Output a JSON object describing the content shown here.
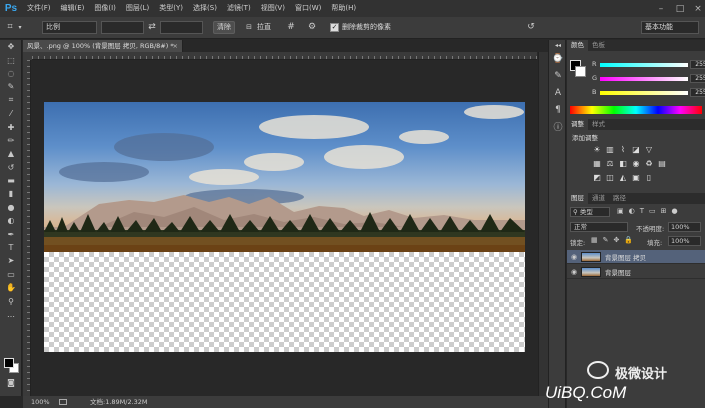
{
  "app": {
    "logo": "Ps"
  },
  "menu": [
    "文件(F)",
    "编辑(E)",
    "图像(I)",
    "图层(L)",
    "类型(Y)",
    "选择(S)",
    "滤镜(T)",
    "视图(V)",
    "窗口(W)",
    "帮助(H)"
  ],
  "options": {
    "ratio": "比例",
    "clear_label": "清除",
    "straighten_label": "拉直",
    "delete_pixels_label": "删除裁剪的像素",
    "delete_pixels_checked": true,
    "workspace": "基本功能"
  },
  "document": {
    "tab_title": "风景、.png @ 100% (背景图层 拷贝, RGB/8#) *",
    "close": "×"
  },
  "status": {
    "zoom": "100%",
    "doc_size": "文档:1.89M/2.32M"
  },
  "color_panel": {
    "tabs": [
      "颜色",
      "色板"
    ],
    "rows": [
      {
        "label": "R",
        "value": "255",
        "gradient": "#00ffff,#ffffff"
      },
      {
        "label": "G",
        "value": "255",
        "gradient": "#ff00ff,#ffffff"
      },
      {
        "label": "B",
        "value": "255",
        "gradient": "#ffff00,#ffffff"
      }
    ]
  },
  "adjust_panel": {
    "tabs": [
      "调整",
      "样式"
    ],
    "title": "添加调整"
  },
  "layers_panel": {
    "tabs": [
      "图层",
      "通道",
      "路径"
    ],
    "filter": "类型",
    "blend_mode": "正常",
    "opacity_label": "不透明度:",
    "opacity_value": "100%",
    "lock_label": "锁定:",
    "fill_label": "填充:",
    "fill_value": "100%",
    "layers": [
      {
        "name": "背景图层 拷贝",
        "selected": true
      },
      {
        "name": "背景图层",
        "selected": false
      }
    ]
  },
  "watermark": {
    "title": "极微设计",
    "site": "UiBQ.CoM"
  }
}
